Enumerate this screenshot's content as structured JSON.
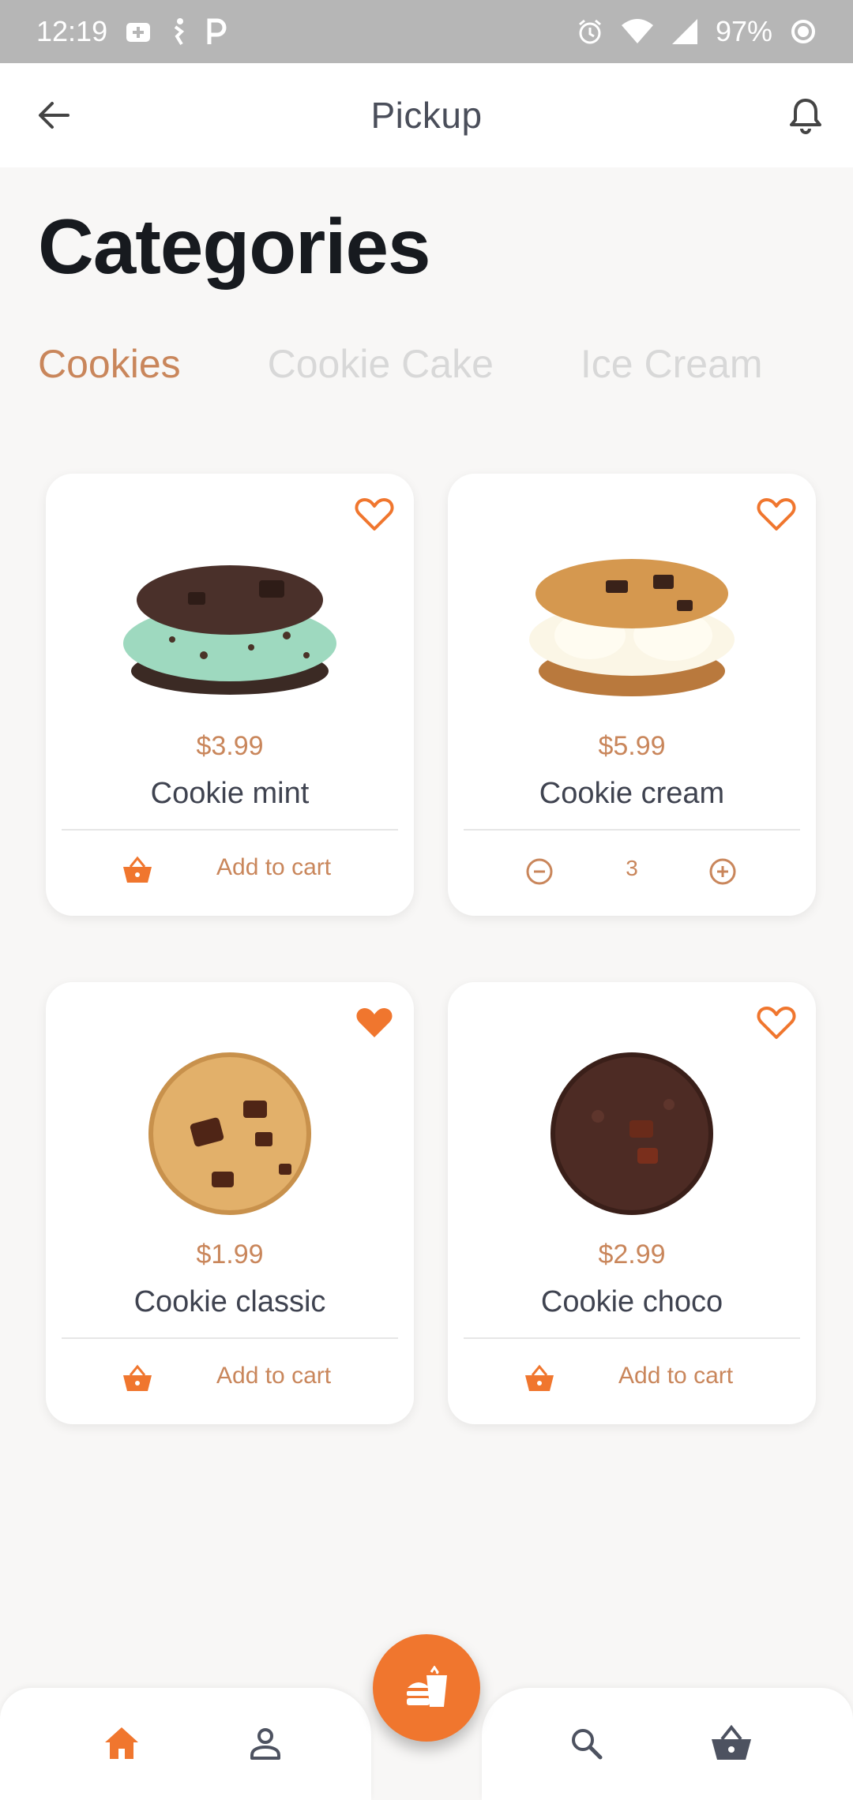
{
  "status_bar": {
    "time": "12:19",
    "battery": "97%",
    "icons": [
      "health-icon",
      "bike-icon",
      "parking-icon",
      "alarm-icon",
      "wifi-icon",
      "signal-icon",
      "battery-ring-icon"
    ]
  },
  "app_bar": {
    "title": "Pickup",
    "back_icon": "arrow-left-icon",
    "bell_icon": "bell-icon"
  },
  "page": {
    "heading": "Categories"
  },
  "tabs": [
    {
      "label": "Cookies",
      "active": true
    },
    {
      "label": "Cookie Cake",
      "active": false
    },
    {
      "label": "Ice Cream",
      "active": false
    }
  ],
  "products": [
    {
      "price": "$3.99",
      "name": "Cookie mint",
      "favorite": false,
      "action": "Add to cart",
      "image": "mint-ice-cream-sandwich"
    },
    {
      "price": "$5.99",
      "name": "Cookie cream",
      "favorite": false,
      "quantity": "3",
      "image": "vanilla-ice-cream-sandwich"
    },
    {
      "price": "$1.99",
      "name": "Cookie classic",
      "favorite": true,
      "action": "Add to cart",
      "image": "chocolate-chunk-cookie"
    },
    {
      "price": "$2.99",
      "name": "Cookie choco",
      "favorite": false,
      "action": "Add to cart",
      "image": "double-chocolate-cookie"
    }
  ],
  "bottom_nav": {
    "items": [
      "home-icon",
      "profile-icon",
      "fast-food-icon",
      "search-icon",
      "basket-icon"
    ],
    "active": "home-icon"
  },
  "colors": {
    "accent": "#c9865b",
    "brand_orange": "#f0762e",
    "heading": "#171a1f",
    "tab_inactive": "#d8d8d8",
    "background": "#f8f7f6",
    "status_bar": "#b6b6b6"
  }
}
